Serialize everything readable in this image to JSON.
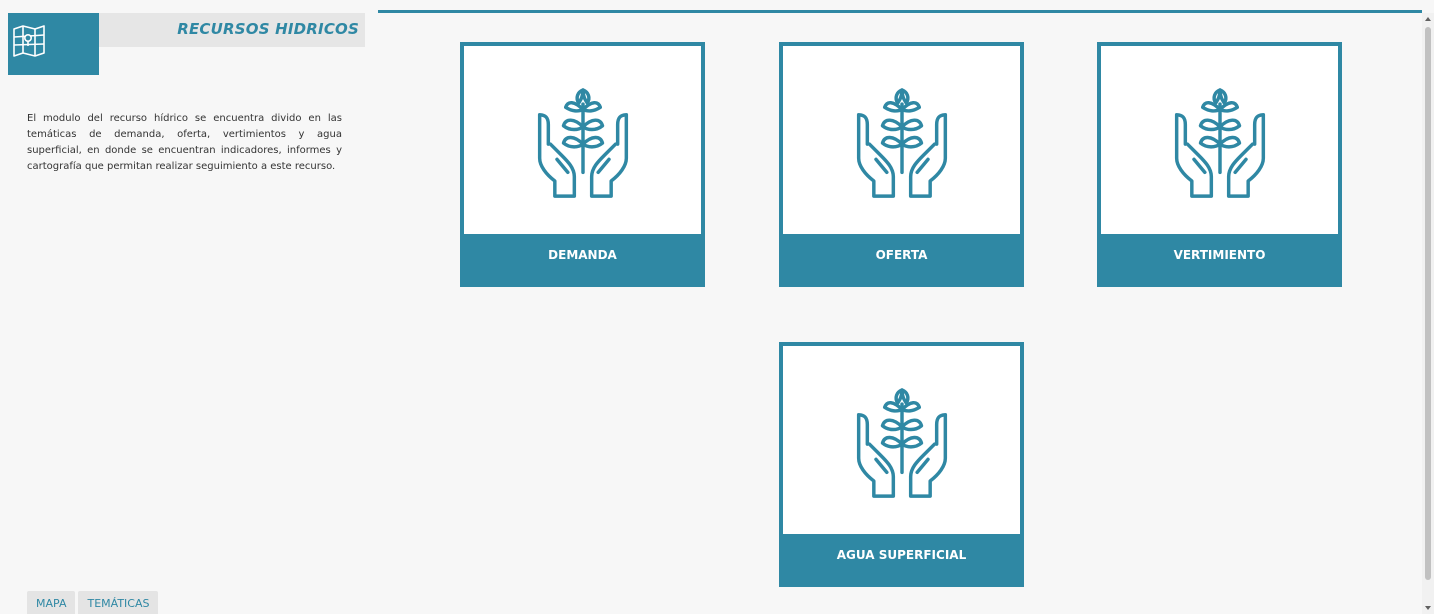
{
  "header": {
    "title": "RECURSOS HIDRICOS",
    "logo_icon": "map-icon"
  },
  "description": "El modulo del recurso hídrico se encuentra divido en las temáticas de demanda, oferta, vertimientos y agua superficial, en donde se encuentran indicadores, informes y cartografía que permitan realizar seguimiento a este recurso.",
  "tabs": [
    {
      "label": "MAPA"
    },
    {
      "label": "TEMÁTICAS"
    }
  ],
  "cards": [
    {
      "label": "DEMANDA",
      "icon": "hands-plant-icon"
    },
    {
      "label": "OFERTA",
      "icon": "hands-plant-icon"
    },
    {
      "label": "VERTIMIENTO",
      "icon": "hands-plant-icon"
    },
    {
      "label": "AGUA SUPERFICIAL",
      "icon": "hands-plant-icon"
    }
  ],
  "colors": {
    "accent": "#2f88a4",
    "background": "#f7f7f7",
    "header_band": "#e6e6e6"
  }
}
